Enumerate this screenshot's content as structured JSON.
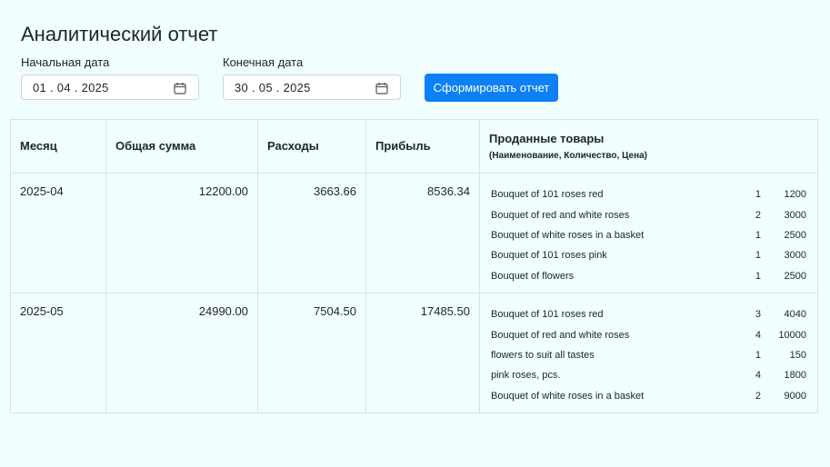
{
  "page": {
    "title": "Аналитический отчет"
  },
  "filters": {
    "start_label": "Начальная дата",
    "start_value": "01 . 04 . 2025",
    "end_label": "Конечная дата",
    "end_value": "30 . 05 . 2025",
    "calendar_icon": "calendar-icon",
    "submit_label": "Сформировать отчет"
  },
  "colors": {
    "accent": "#0d80f6",
    "background": "#f0fffe",
    "border": "#d7e3e3"
  },
  "table": {
    "headers": {
      "month": "Месяц",
      "total": "Общая сумма",
      "expenses": "Расходы",
      "profit": "Прибыль",
      "products": "Проданные товары",
      "products_sub": "(Наименование, Количество, Цена)"
    },
    "rows": [
      {
        "month": "2025-04",
        "total": "12200.00",
        "expenses": "3663.66",
        "profit": "8536.34",
        "products": [
          {
            "name": "Bouquet of 101 roses red",
            "qty": "1",
            "price": "1200"
          },
          {
            "name": "Bouquet of red and white roses",
            "qty": "2",
            "price": "3000"
          },
          {
            "name": "Bouquet of white roses in a basket",
            "qty": "1",
            "price": "2500"
          },
          {
            "name": "Bouquet of 101 roses pink",
            "qty": "1",
            "price": "3000"
          },
          {
            "name": "Bouquet of flowers",
            "qty": "1",
            "price": "2500"
          }
        ]
      },
      {
        "month": "2025-05",
        "total": "24990.00",
        "expenses": "7504.50",
        "profit": "17485.50",
        "products": [
          {
            "name": "Bouquet of 101 roses red",
            "qty": "3",
            "price": "4040"
          },
          {
            "name": "Bouquet of red and white roses",
            "qty": "4",
            "price": "10000"
          },
          {
            "name": "flowers to suit all tastes",
            "qty": "1",
            "price": "150"
          },
          {
            "name": "pink roses, pcs.",
            "qty": "4",
            "price": "1800"
          },
          {
            "name": "Bouquet of white roses in a basket",
            "qty": "2",
            "price": "9000"
          }
        ]
      }
    ]
  }
}
